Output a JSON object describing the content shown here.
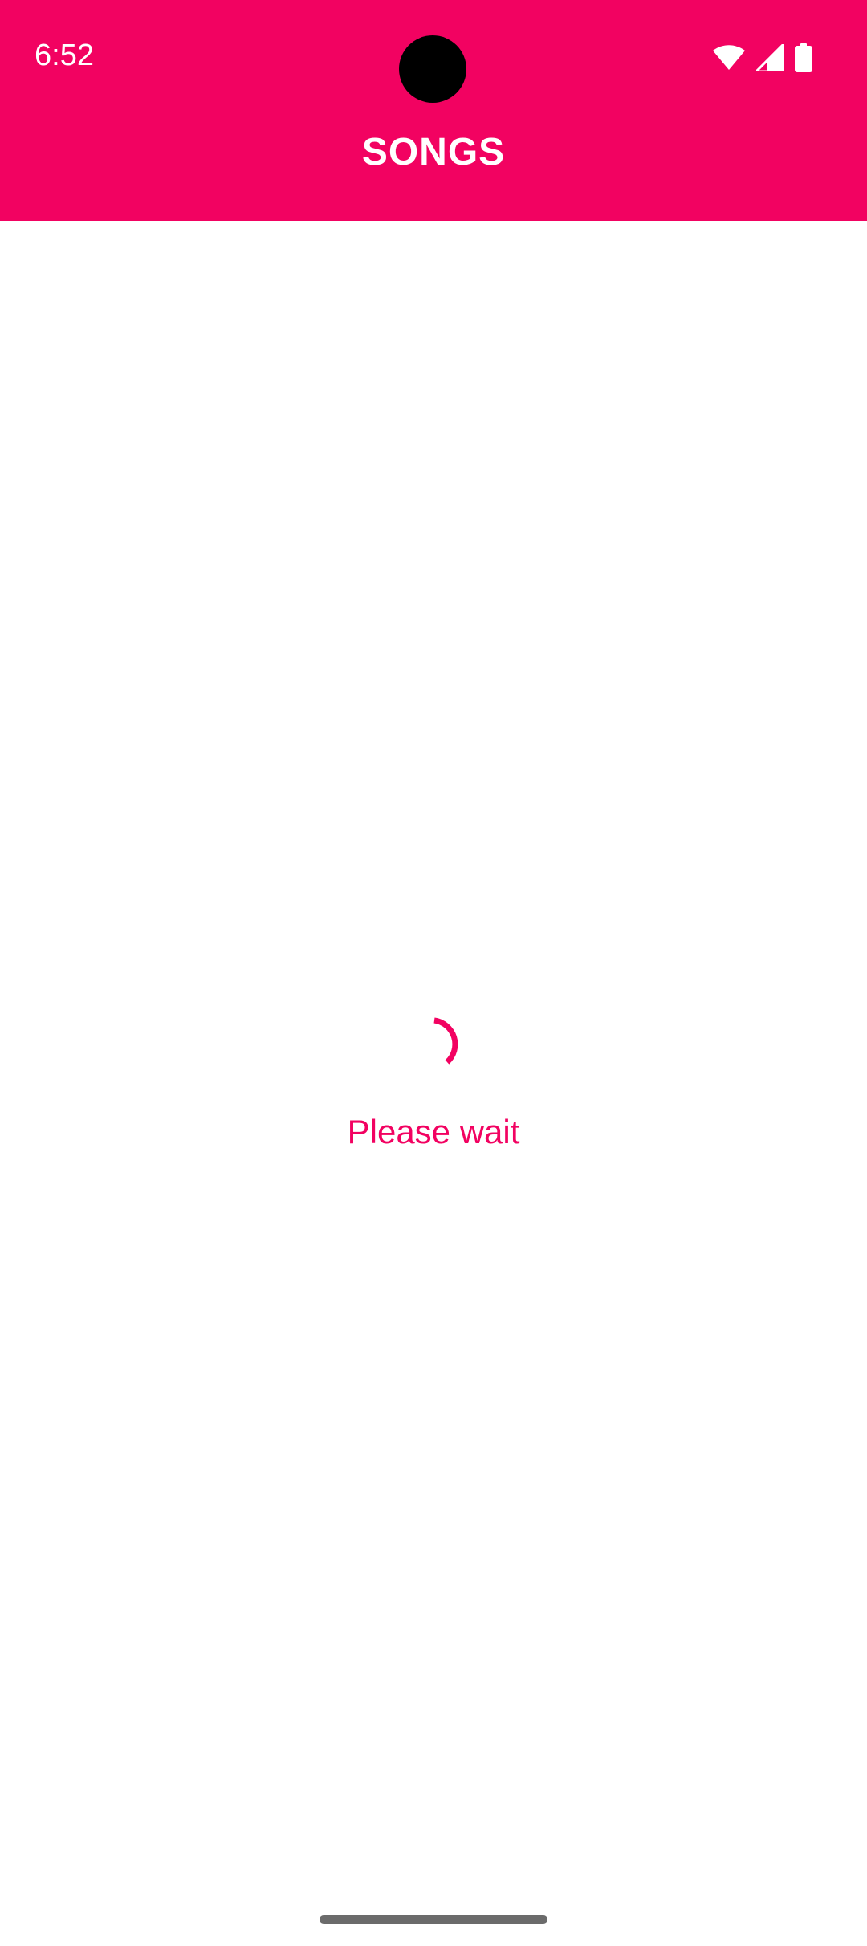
{
  "status_bar": {
    "time": "6:52",
    "icons": [
      "wifi-icon",
      "cellular-signal-icon",
      "battery-icon"
    ]
  },
  "app_bar": {
    "title": "SONGS"
  },
  "loading": {
    "message": "Please wait",
    "indicator": "circular-progress"
  },
  "colors": {
    "accent": "#f20261",
    "background": "#ffffff",
    "on_accent": "#ffffff"
  }
}
